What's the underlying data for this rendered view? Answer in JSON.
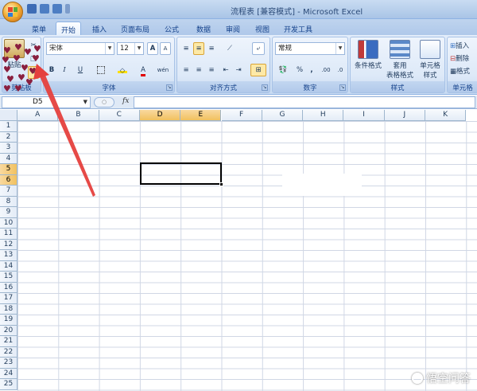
{
  "window": {
    "title_doc": "流程表  [兼容模式]",
    "title_app": "- Microsoft Excel"
  },
  "tabs": [
    {
      "label": "菜单"
    },
    {
      "label": "开始"
    },
    {
      "label": "插入"
    },
    {
      "label": "页面布局"
    },
    {
      "label": "公式"
    },
    {
      "label": "数据"
    },
    {
      "label": "审阅"
    },
    {
      "label": "视图"
    },
    {
      "label": "开发工具"
    }
  ],
  "ribbon": {
    "clipboard": {
      "paste_label": "粘贴",
      "group_label": "剪贴板"
    },
    "font": {
      "font_name": "宋体",
      "font_size": "12",
      "grow_label": "A",
      "shrink_label": "A",
      "bold": "B",
      "italic": "I",
      "underline": "U",
      "font_color_label": "A",
      "wen_label": "wén",
      "group_label": "字体"
    },
    "alignment": {
      "group_label": "对齐方式"
    },
    "number": {
      "format": "常规",
      "percent": "%",
      "comma": ",",
      "decimals": ".00",
      "group_label": "数字"
    },
    "styles": {
      "conditional": "条件格式",
      "table_line1": "套用",
      "table_line2": "表格格式",
      "cell_line1": "单元格",
      "cell_line2": "样式",
      "group_label": "样式"
    },
    "cells": {
      "insert": "插入",
      "delete": "删除",
      "format": "格式",
      "group_label": "单元格"
    }
  },
  "formula_bar": {
    "name_box": "D5",
    "fx": "fx",
    "formula": ""
  },
  "grid": {
    "columns": [
      "A",
      "B",
      "C",
      "D",
      "E",
      "F",
      "G",
      "H",
      "I",
      "J",
      "K"
    ],
    "selected_columns": [
      "D",
      "E"
    ],
    "rows": [
      "1",
      "2",
      "3",
      "4",
      "5",
      "6",
      "7",
      "8",
      "9",
      "10",
      "11",
      "12",
      "13",
      "14",
      "15",
      "16",
      "17",
      "18",
      "19",
      "20",
      "21",
      "22",
      "23",
      "24",
      "25"
    ],
    "selected_rows": [
      "5",
      "6"
    ]
  },
  "watermark": {
    "text": "悟空问答"
  },
  "colors": {
    "accent": "#f3b13b",
    "selection_header": "#f1c15f",
    "annotation_arrow": "#e5403d",
    "hearts": "#8a1f3f"
  }
}
